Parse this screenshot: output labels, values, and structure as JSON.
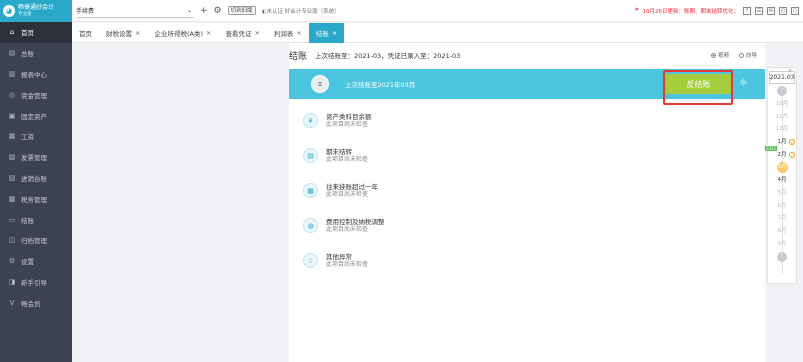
{
  "app": {
    "logo_line1": "畅捷通好会计",
    "logo_line2": "专业版"
  },
  "sidebar": {
    "items": [
      {
        "icon": "⌂",
        "label": "首页",
        "active": true
      },
      {
        "icon": "▤",
        "label": "总账"
      },
      {
        "icon": "▥",
        "label": "报表中心"
      },
      {
        "icon": "◎",
        "label": "资金管理"
      },
      {
        "icon": "▣",
        "label": "固定资产"
      },
      {
        "icon": "▦",
        "label": "工资"
      },
      {
        "icon": "▧",
        "label": "发票管理"
      },
      {
        "icon": "▨",
        "label": "进销台账"
      },
      {
        "icon": "▩",
        "label": "税务管理"
      },
      {
        "icon": "▭",
        "label": "结账"
      },
      {
        "icon": "◫",
        "label": "归档管理"
      },
      {
        "icon": "⚙",
        "label": "设置"
      },
      {
        "icon": "◨",
        "label": "新手引导"
      },
      {
        "icon": "V",
        "label": "畅会员"
      }
    ]
  },
  "topbar": {
    "company": "手续费",
    "add_icon": "+",
    "settings_icon": "⚙",
    "switch_label": "切到旧版",
    "info": "◐未认证  好会计专业版（系统）",
    "notice": "10月26日更新：账期、期末结转优化；",
    "right_icons": [
      "?",
      "☰",
      "✉",
      "◰",
      "▢"
    ]
  },
  "tabs": [
    {
      "label": "首页",
      "closable": false
    },
    {
      "label": "财税设置",
      "closable": true
    },
    {
      "label": "企业所得税(A类)",
      "closable": true
    },
    {
      "label": "查看凭证",
      "closable": true
    },
    {
      "label": "利润表",
      "closable": true
    },
    {
      "label": "结账",
      "closable": true,
      "active": true
    }
  ],
  "closing": {
    "title": "结账",
    "subtitle": "上次结账至：2021-03，凭证已录入至：2021-03",
    "view_options": [
      "视频",
      "向导"
    ],
    "banner_text": "上次结账至2021年03月",
    "unclose_button": "反结账",
    "checks": [
      {
        "icon": "¥",
        "title": "资产类科目余额",
        "status": "此项目尚未检查"
      },
      {
        "icon": "▤",
        "title": "期末结转",
        "status": "此项目尚未检查"
      },
      {
        "icon": "▦",
        "title": "往来挂账超过一年",
        "status": "此项目尚未检查"
      },
      {
        "icon": "◍",
        "title": "费用控制及纳税调整",
        "status": "此项目尚未检查"
      },
      {
        "icon": "☆",
        "title": "其他异常",
        "status": "此项目尚未检查"
      }
    ]
  },
  "timeline": {
    "year": "2021.03",
    "year_flag": "2021",
    "months": [
      {
        "label": "10月",
        "state": "future"
      },
      {
        "label": "11月",
        "state": "future"
      },
      {
        "label": "12月",
        "state": "future"
      },
      {
        "label": "1月",
        "state": "done"
      },
      {
        "label": "2月",
        "state": "done"
      },
      {
        "label": "3月",
        "state": "current"
      },
      {
        "label": "4月",
        "state": "open"
      },
      {
        "label": "5月",
        "state": "future"
      },
      {
        "label": "6月",
        "state": "future"
      },
      {
        "label": "7月",
        "state": "future"
      },
      {
        "label": "8月",
        "state": "future"
      },
      {
        "label": "9月",
        "state": "future"
      }
    ]
  },
  "colors": {
    "accent": "#2aa7c9",
    "banner": "#4cc6e0",
    "button": "#a4cc3c",
    "highlight": "#e53935",
    "sidebar": "#3c4250"
  }
}
